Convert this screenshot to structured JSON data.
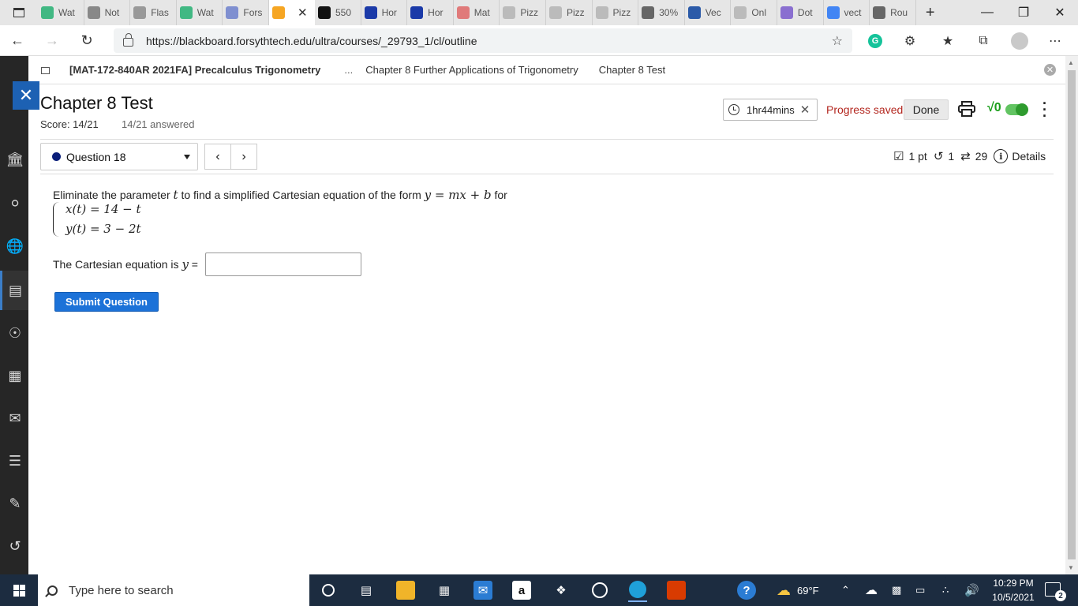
{
  "browser": {
    "tabs": [
      {
        "label": "Wat",
        "icon": "vue-icon",
        "color": "#41b883"
      },
      {
        "label": "Not",
        "icon": "notion-icon",
        "color": "#888888"
      },
      {
        "label": "Flas",
        "icon": "page-icon",
        "color": "#999999"
      },
      {
        "label": "Wat",
        "icon": "vue-icon",
        "color": "#41b883"
      },
      {
        "label": "Fors",
        "icon": "shield-icon",
        "color": "#7f8fd0"
      },
      {
        "label": "",
        "icon": "pencil-icon",
        "color": "#f6a623",
        "active": true
      },
      {
        "label": "550",
        "icon": "blackboard-icon",
        "color": "#111111"
      },
      {
        "label": "Hor",
        "icon": "star-icon",
        "color": "#1b3aa8"
      },
      {
        "label": "Hor",
        "icon": "star-icon",
        "color": "#1b3aa8"
      },
      {
        "label": "Mat",
        "icon": "mail-icon",
        "color": "#e07a7a"
      },
      {
        "label": "Pizz",
        "icon": "pizza-icon",
        "color": "#bbbbbb"
      },
      {
        "label": "Pizz",
        "icon": "pizza-icon",
        "color": "#bbbbbb"
      },
      {
        "label": "Pizz",
        "icon": "pizza-icon",
        "color": "#bbbbbb"
      },
      {
        "label": "30%",
        "icon": "r-icon",
        "color": "#666666"
      },
      {
        "label": "Vec",
        "icon": "vector-icon",
        "color": "#2b5aa8"
      },
      {
        "label": "Onl",
        "icon": "math-icon",
        "color": "#bbbbbb"
      },
      {
        "label": "Dot",
        "icon": "dot-icon",
        "color": "#8a6fd0"
      },
      {
        "label": "vect",
        "icon": "google-icon",
        "color": "#4285f4"
      },
      {
        "label": "Rou",
        "icon": "sigma-icon",
        "color": "#666666"
      }
    ],
    "url": "https://blackboard.forsythtech.edu/ultra/courses/_29793_1/cl/outline",
    "accent": "#1d61b3"
  },
  "breadcrumb": {
    "course": "[MAT-172-840AR 2021FA] Precalculus Trigonometry",
    "ellipsis": "...",
    "chapter": "Chapter 8 Further Applications of Trigonometry",
    "current": "Chapter 8 Test"
  },
  "test": {
    "title": "Chapter 8 Test",
    "score": "Score: 14/21",
    "answered": "14/21 answered",
    "timer": "1hr44mins",
    "progress": "Progress saved",
    "done_label": "Done",
    "sqrt_label": "√0"
  },
  "question": {
    "selector": "Question 18",
    "prev": "‹",
    "next": "›",
    "points": "1 pt",
    "attempts": "1",
    "retries": "29",
    "details": "Details",
    "text_intro": "Eliminate the parameter ",
    "text_param": "t",
    "text_mid": " to find a simplified Cartesian equation of the form ",
    "text_form": "y = mx + b",
    "text_end": " for",
    "eq1": "x(t) = 14 − t",
    "eq2": "y(t) = 3 − 2t",
    "answer_label": "The Cartesian equation is ",
    "answer_var": "y",
    "answer_eq": " =",
    "answer_value": "",
    "submit": "Submit Question"
  },
  "taskbar": {
    "search_placeholder": "Type here to search",
    "weather": "69°F",
    "time": "10:29 PM",
    "date": "10/5/2021",
    "notifications": "2"
  }
}
